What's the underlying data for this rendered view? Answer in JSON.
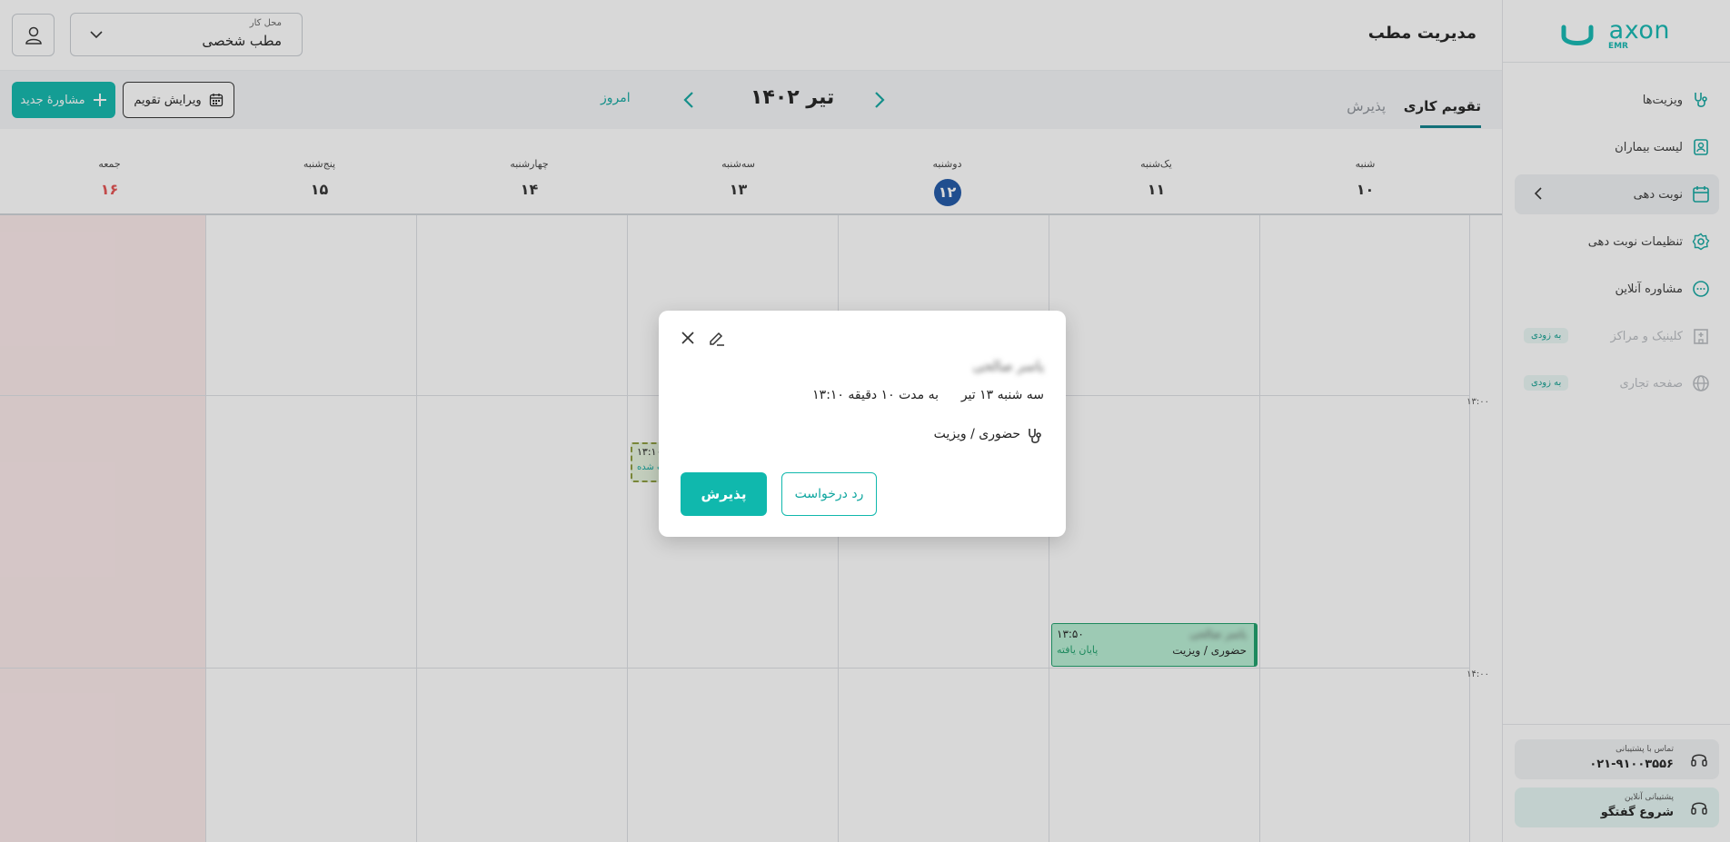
{
  "app": {
    "logo_text": "axon",
    "logo_sub": "EMR"
  },
  "header": {
    "title": "مدیریت مطب",
    "location_label": "محل کار",
    "location_value": "مطب شخصی"
  },
  "sidebar": {
    "items": [
      {
        "label": "ویزیت‌ها",
        "icon": "stethoscope-icon"
      },
      {
        "label": "لیست بیماران",
        "icon": "patient-list-icon"
      },
      {
        "label": "نوبت دهی",
        "icon": "calendar-icon"
      },
      {
        "label": "تنظیمات نوبت دهی",
        "icon": "gear-icon"
      },
      {
        "label": "مشاوره آنلاین",
        "icon": "chat-icon"
      },
      {
        "label": "کلینیک و مراکز",
        "icon": "building-icon",
        "badge": "به زودی"
      },
      {
        "label": "صفحه تجاری",
        "icon": "globe-icon",
        "badge": "به زودی"
      }
    ],
    "support_title": "تماس با پشتیبانی",
    "support_phone": "۰۲۱-۹۱۰۰۳۵۵۶",
    "chat_title": "پشتیبانی آنلاین",
    "chat_action": "شروع گفتگو"
  },
  "toolbar": {
    "tab_calendar": "تقویم کاری",
    "tab_reception": "پذیرش",
    "month": "تیر ۱۴۰۲",
    "today": "امروز",
    "edit_calendar": "ویرایش تقویم",
    "new_consult": "مشاورهٔ جدید"
  },
  "days": [
    {
      "name": "شنبه",
      "num": "۱۰"
    },
    {
      "name": "یک‌شنبه",
      "num": "۱۱"
    },
    {
      "name": "دوشنبه",
      "num": "۱۲"
    },
    {
      "name": "سه‌شنبه",
      "num": "۱۳"
    },
    {
      "name": "چهارشنبه",
      "num": "۱۴"
    },
    {
      "name": "پنج‌شنبه",
      "num": "۱۵"
    },
    {
      "name": "جمعه",
      "num": "۱۶"
    }
  ],
  "hours": [
    "۱۳:۰۰",
    "۱۴:۰۰"
  ],
  "events": {
    "e1": {
      "time": "۱۳:۵۰",
      "status": "پایان یافته",
      "name": "یاسر صالحی",
      "type": "حضوری / ویزیت"
    },
    "e2": {
      "time": "۱۳:۱۰",
      "status": "ثبت شده"
    }
  },
  "modal": {
    "name": "یاسر صالحی",
    "date": "سه شنبه ۱۳ تیر",
    "time": "۱۳:۱۰ به مدت ۱۰ دقیقه",
    "type": "حضوری / ویزیت",
    "accept": "پذیرش",
    "reject": "رد درخواست"
  },
  "colors": {
    "brand": "#10b8ad",
    "today_circle": "#1f57a6",
    "holiday": "#e45252",
    "event_done": "#b8eed4"
  }
}
